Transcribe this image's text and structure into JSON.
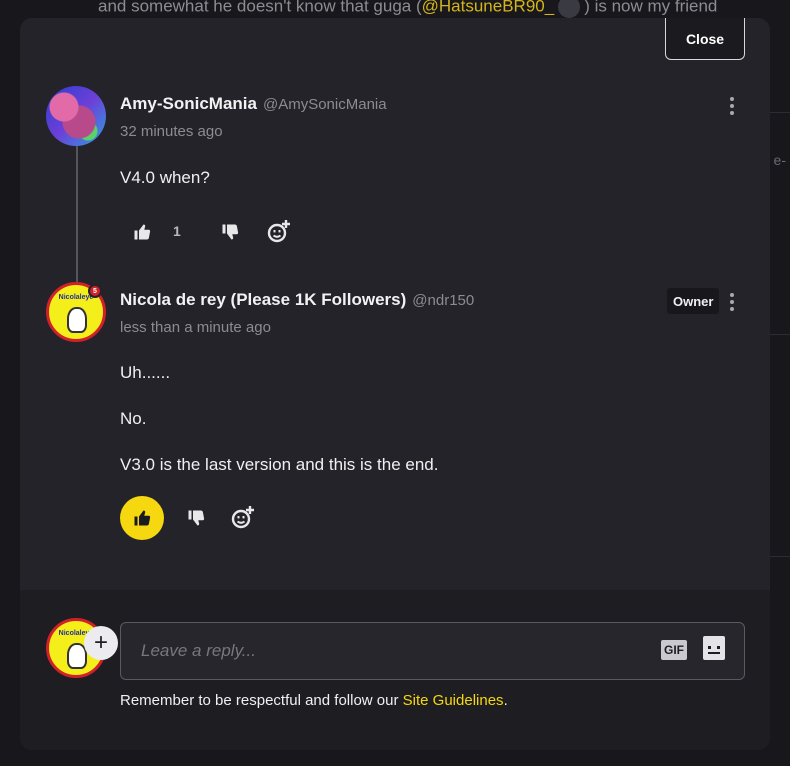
{
  "background": {
    "text_before": "and somewhat he doesn't know that guga (",
    "mention": "@HatsuneBR90_",
    "text_after": ") is now my friend",
    "fragment": "e-"
  },
  "modal": {
    "close_label": "Close"
  },
  "comments": [
    {
      "username": "Amy-SonicMania",
      "handle": "@AmySonicMania",
      "timestamp": "32 minutes ago",
      "body": [
        "V4.0 when?"
      ],
      "like_count": "1",
      "liked": false,
      "avatar_icon": "amy-avatar"
    },
    {
      "username": "Nicola de rey (Please 1K Followers)",
      "handle": "@ndr150",
      "timestamp": "less than a minute ago",
      "badge": "Owner",
      "body": [
        "Uh......",
        "No.",
        "V3.0 is the last version and this is the end."
      ],
      "like_count": "",
      "liked": true,
      "avatar_icon": "nicola-avatar",
      "avatar_text": "Nicolaleye",
      "avatar_badge": "5"
    }
  ],
  "reply": {
    "placeholder": "Leave a reply...",
    "gif_label": "GIF",
    "add_label": "+",
    "guideline_prefix": "Remember to be respectful and follow our ",
    "guideline_link": "Site Guidelines",
    "guideline_suffix": "."
  },
  "colors": {
    "accent": "#f5d80f",
    "modal_bg": "#232329",
    "footer_bg": "#1d1d22"
  }
}
